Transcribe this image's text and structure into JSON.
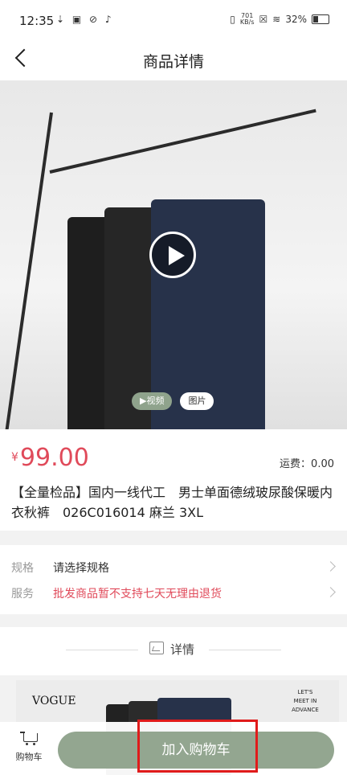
{
  "statusbar": {
    "time": "12:35",
    "icons": "⇣ ▣ ⊘ ♪",
    "netspeed_top": "701",
    "netspeed_bottom": "KB/s",
    "battery": "32%"
  },
  "nav": {
    "title": "商品详情"
  },
  "gallery": {
    "tab_video": "▶视频",
    "tab_image": "图片"
  },
  "product": {
    "currency": "¥",
    "price": "99.00",
    "shipping": "运费：0.00",
    "title": "【全量检品】国内一线代工　男士单面德绒玻尿酸保暖内衣秋裤　026C016014 麻兰 3XL"
  },
  "spec": {
    "spec_label": "规格",
    "spec_value": "请选择规格",
    "service_label": "服务",
    "service_value": "批发商品暂不支持七天无理由退货"
  },
  "detail": {
    "heading": "详情",
    "image_brand": "VOGUE",
    "image_tag": "LET'S MEET IN ADVANCE"
  },
  "bottom": {
    "cart_label": "购物车",
    "add_to_cart": "加入购物车"
  },
  "colors": {
    "accent": "#93a690",
    "price": "#e04a5a"
  }
}
